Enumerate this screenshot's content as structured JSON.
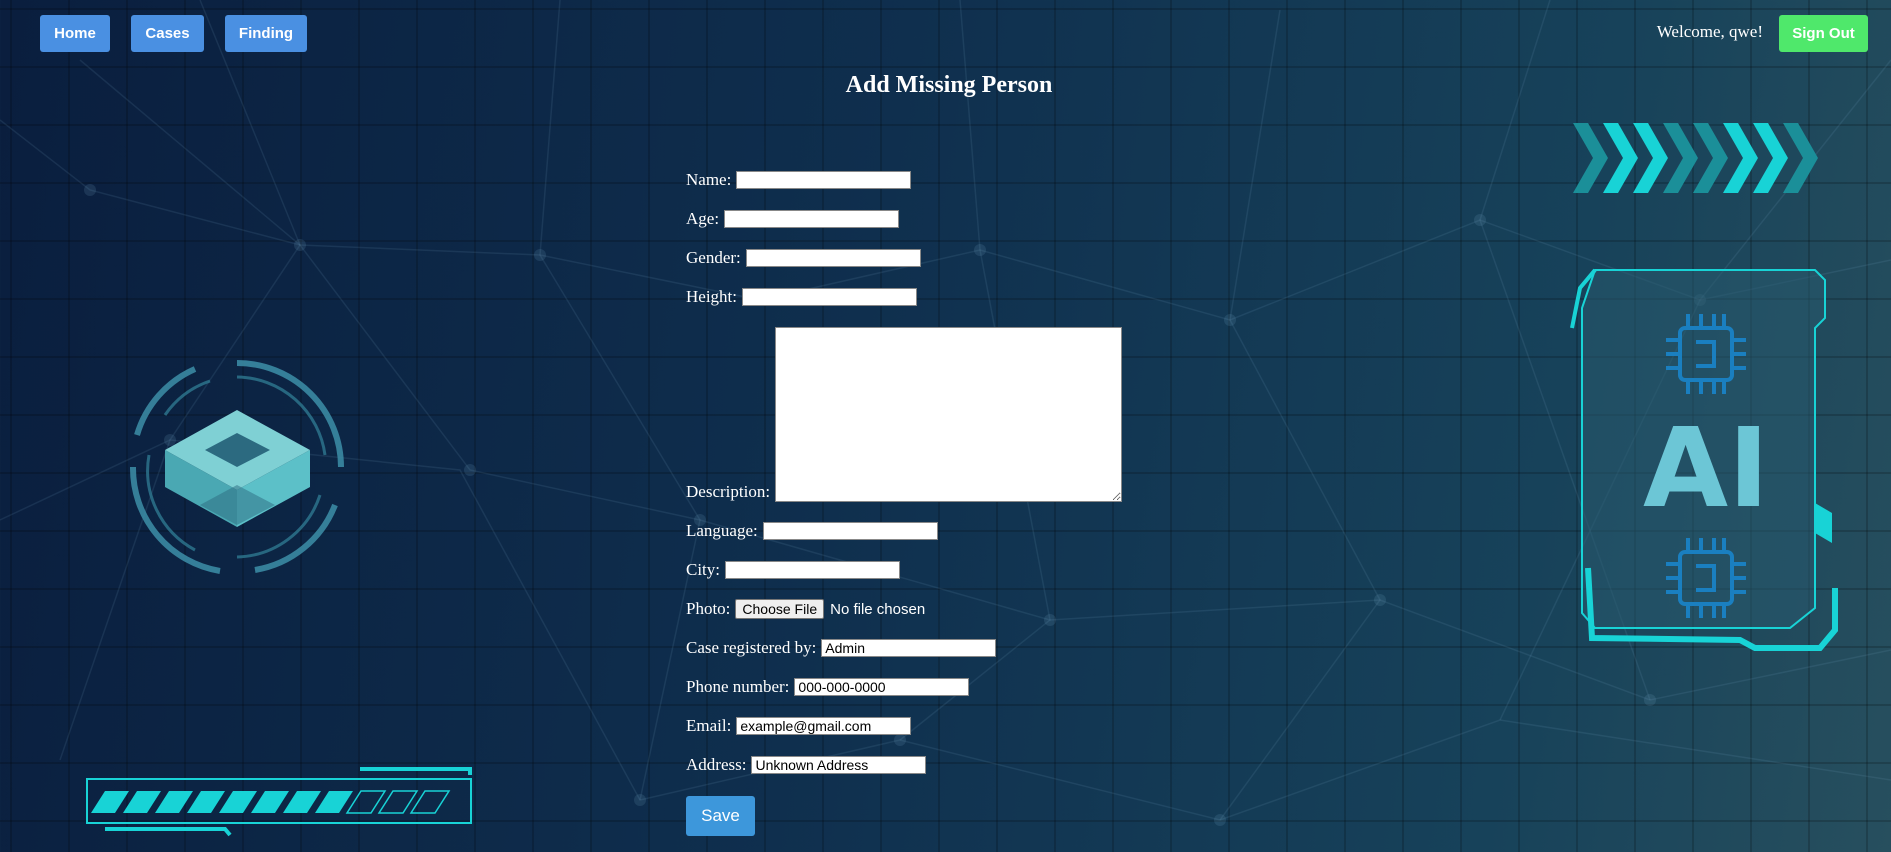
{
  "nav": {
    "home": "Home",
    "cases": "Cases",
    "finding": "Finding"
  },
  "header": {
    "welcome": "Welcome, qwe!",
    "signout": "Sign Out"
  },
  "page": {
    "title": "Add Missing Person"
  },
  "form": {
    "name_label": "Name:",
    "age_label": "Age:",
    "gender_label": "Gender:",
    "height_label": "Height:",
    "description_label": "Description:",
    "language_label": "Language:",
    "city_label": "City:",
    "photo_label": "Photo:",
    "photo_button": "Choose File",
    "photo_status": "No file chosen",
    "registered_by_label": "Case registered by:",
    "registered_by_value": "Admin",
    "phone_label": "Phone number:",
    "phone_value": "000-000-0000",
    "email_label": "Email:",
    "email_value": "example@gmail.com",
    "address_label": "Address:",
    "address_value": "Unknown Address",
    "save": "Save"
  },
  "decor": {
    "ai_text": "AI",
    "progress_filled_segments": 9,
    "progress_total_segments": 12
  },
  "colors": {
    "nav_button": "#4a90e2",
    "signout_button": "#4fe86b",
    "save_button": "#3d97db",
    "accent_cyan": "#18d3d6"
  }
}
